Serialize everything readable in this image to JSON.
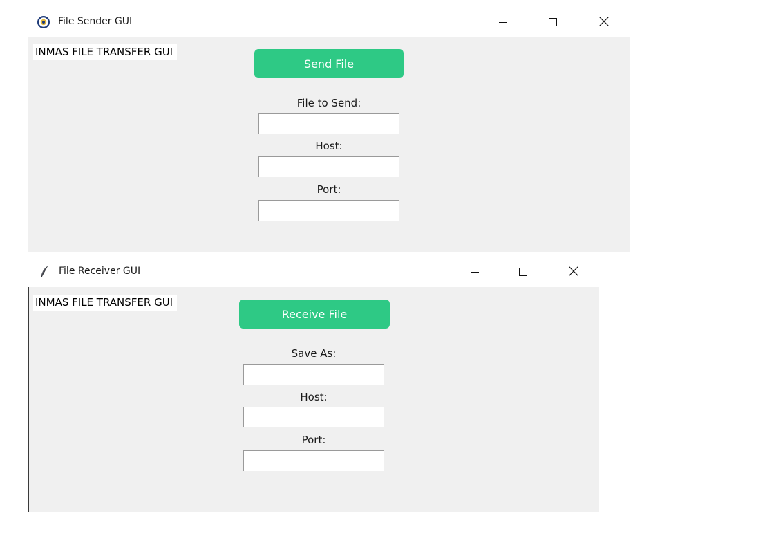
{
  "sender": {
    "title": "File Sender GUI",
    "app_label": "INMAS FILE TRANSFER GUI",
    "button_label": "Send File",
    "fields": [
      {
        "label": "File to Send:",
        "value": ""
      },
      {
        "label": "Host:",
        "value": ""
      },
      {
        "label": "Port:",
        "value": ""
      }
    ],
    "icon": "globe-seal-icon"
  },
  "receiver": {
    "title": "File Receiver GUI",
    "app_label": "INMAS FILE TRANSFER GUI",
    "button_label": "Receive File",
    "fields": [
      {
        "label": "Save As:",
        "value": ""
      },
      {
        "label": "Host:",
        "value": ""
      },
      {
        "label": "Port:",
        "value": ""
      }
    ],
    "icon": "feather-icon"
  },
  "window_controls": [
    "minimize-icon",
    "maximize-icon",
    "close-icon"
  ],
  "colors": {
    "accent": "#2ec985",
    "content_bg": "#f0f0f0",
    "titlebar_bg": "#ffffff"
  }
}
